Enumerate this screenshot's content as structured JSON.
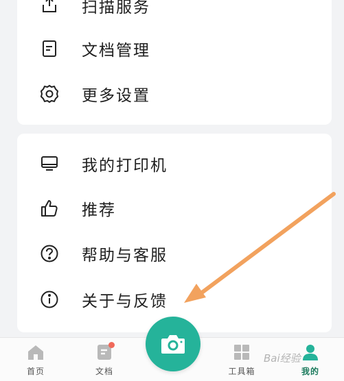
{
  "menu_group_1": [
    {
      "label": "扫描服务",
      "icon": "scan-upload-icon"
    },
    {
      "label": "文档管理",
      "icon": "document-icon"
    },
    {
      "label": "更多设置",
      "icon": "gear-icon"
    }
  ],
  "menu_group_2": [
    {
      "label": "我的打印机",
      "icon": "printer-icon"
    },
    {
      "label": "推荐",
      "icon": "thumbs-up-icon"
    },
    {
      "label": "帮助与客服",
      "icon": "help-circle-icon"
    },
    {
      "label": "关于与反馈",
      "icon": "info-circle-icon"
    }
  ],
  "tabbar": {
    "home": "首页",
    "docs": "文档",
    "tools": "工具箱",
    "me": "我的"
  },
  "watermark": "Bai经验",
  "colors": {
    "accent": "#25b39a",
    "active_tab": "#1a7a5c",
    "arrow": "#f2a25e",
    "badge": "#f0695a"
  }
}
